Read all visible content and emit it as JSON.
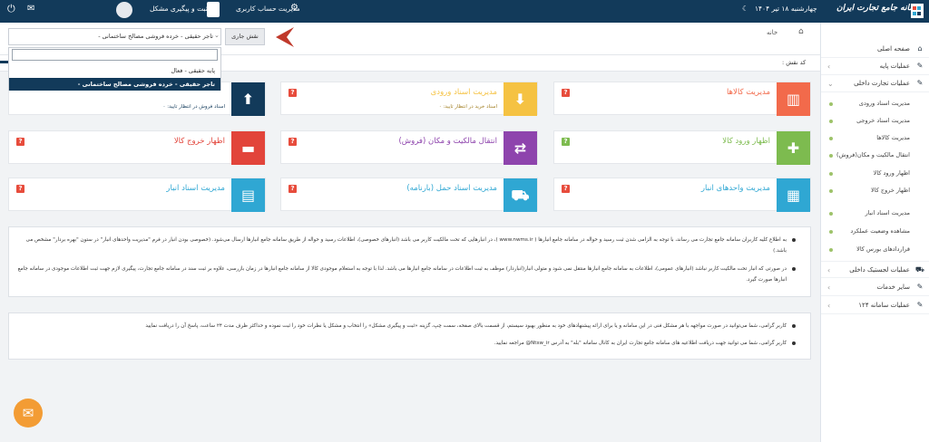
{
  "header": {
    "brand": "سامانه جامع تجارت ایران",
    "date": "چهارشنبه ۱۸ تیر ۱۴۰۴",
    "account": "مدیریت حساب کاربری",
    "support": "ثبت و پیگیری مشکل",
    "user_name": ""
  },
  "role_bar": {
    "label": "نقش جاری",
    "selected": "تاجر حقیقی - خرده فروشی مصالح ساختمانی -",
    "options": [
      "پایه حقیقی - فعال",
      "تاجر حقیقی - خرده فروشی مصالح ساختمانی -"
    ],
    "search_value": ""
  },
  "breadcrumb": {
    "home": "خانه",
    "role_code_label": "کد نقش :"
  },
  "cards": [
    {
      "title": "مدیریت کالاها",
      "color": "#f26a4b",
      "icon": "chart-icon",
      "sub": "",
      "q_color": "#e74c3c"
    },
    {
      "title": "مدیریت اسناد ورودی",
      "color": "#f5c242",
      "icon": "download-icon",
      "sub": "اسناد خرید در انتظار تایید: ۰",
      "q_color": "#e74c3c"
    },
    {
      "title": "",
      "color": "#123a5a",
      "icon": "upload-icon",
      "sub": "اسناد فروش در انتظار تایید: ۰",
      "q_color": "#e74c3c"
    },
    {
      "title": "اظهار ورود کالا",
      "color": "#7dbb4f",
      "icon": "plus-icon",
      "sub": "",
      "q_color": "#7dbb4f"
    },
    {
      "title": "انتقال مالکیت و مکان (فروش)",
      "color": "#8e44ad",
      "icon": "transfer-icon",
      "sub": "",
      "q_color": "#e74c3c"
    },
    {
      "title": "اظهار خروج کالا",
      "color": "#e2443a",
      "icon": "minus-icon",
      "sub": "",
      "q_color": "#e74c3c"
    },
    {
      "title": "مدیریت واحدهای انبار",
      "color": "#2fa7d3",
      "icon": "boxes-icon",
      "sub": "",
      "q_color": "#e74c3c"
    },
    {
      "title": "مدیریت اسناد حمل (بارنامه)",
      "color": "#2fa7d3",
      "icon": "truck-icon",
      "sub": "",
      "q_color": "#e74c3c"
    },
    {
      "title": "مدیریت اسناد انبار",
      "color": "#2fa7d3",
      "icon": "book-icon",
      "sub": "",
      "q_color": "#e74c3c"
    }
  ],
  "notices": {
    "first": [
      "به اطلاع کلیه کاربران سامانه جامع تجارت می رساند، با توجه به الزامی شدن ثبت رسید و حواله در سامانه جامع انبارها ( www.nwms.ir )، در انبارهایی که تحت مالکیت کاربر می باشد (انبارهای خصوصی)، اطلاعات رسید و حواله از طریق سامانه جامع انبارها ارسال می‌شود. (خصوصی بودن انبار در فرم \"مدیریت واحدهای",
      "انبار\" در ستون \"بهره بردار\" مشخص می باشد.)",
      "در صورتی که انبار تحت مالکیت کاربر نباشد (انبارهای عمومی)، اطلاعات به سامانه جامع انبارها منتقل نمی شود و متولی انبار(انباردار) موظف به ثبت اطلاعات در سامانه جامع انبارها می باشد. لذا با توجه به استعلام موجودی کالا از سامانه جامع انبارها در زمان بازرسی، علاوه بر ثبت سند در سامانه جامع تجارت، پیگیری لازم جهت ثبت اطلاعات",
      "موجودی در سامانه جامع انبارها صورت گیرد."
    ],
    "second": [
      "کاربر گرامی، شما می‌توانید در صورت مواجهه با هر مشکل فنی در این سامانه و یا برای ارائه پیشنهادهای خود به منظور بهبود سیستم، از قسمت بالای صفحه، سمت چپ، گزینه «ثبت و پیگیری مشکل» را انتخاب و مشکل یا نظرات خود را ثبت نموده و حداکثر ظرف مدت ۲۴ ساعت، پاسخ آن را دریافت نمایید",
      "کاربر گرامی، شما می توانید جهت دریافت اطلاعیه های سامانه جامع تجارت ایران به کانال سامانه \"بله\" به آدرس Ntsw_ir@ مراجعه نمایید."
    ]
  },
  "sidebar": {
    "items": [
      {
        "label": "صفحه اصلی",
        "icon": "home-icon",
        "chev": ""
      },
      {
        "label": "عملیات پایه",
        "icon": "edit-icon",
        "chev": "›"
      },
      {
        "label": "عملیات تجارت داخلی",
        "icon": "edit-icon",
        "chev": "⌄"
      }
    ],
    "subitems": [
      "مدیریت اسناد ورودی",
      "مدیریت اسناد خروجی",
      "مدیریت کالاها",
      "انتقال مالکیت و مکان(فروش)",
      "اظهار ورود کالا",
      "اظهار خروج کالا",
      "مدیریت اسناد انبار",
      "مشاهده وضعیت عملکرد",
      "قراردادهای بورس کالا"
    ],
    "bottom": [
      {
        "label": "عملیات لجستیک داخلی",
        "icon": "truck-icon",
        "chev": "›"
      },
      {
        "label": "سایر خدمات",
        "icon": "edit-icon",
        "chev": "›"
      },
      {
        "label": "عملیات سامانه ۱۲۴",
        "icon": "edit-icon",
        "chev": "›"
      }
    ]
  }
}
